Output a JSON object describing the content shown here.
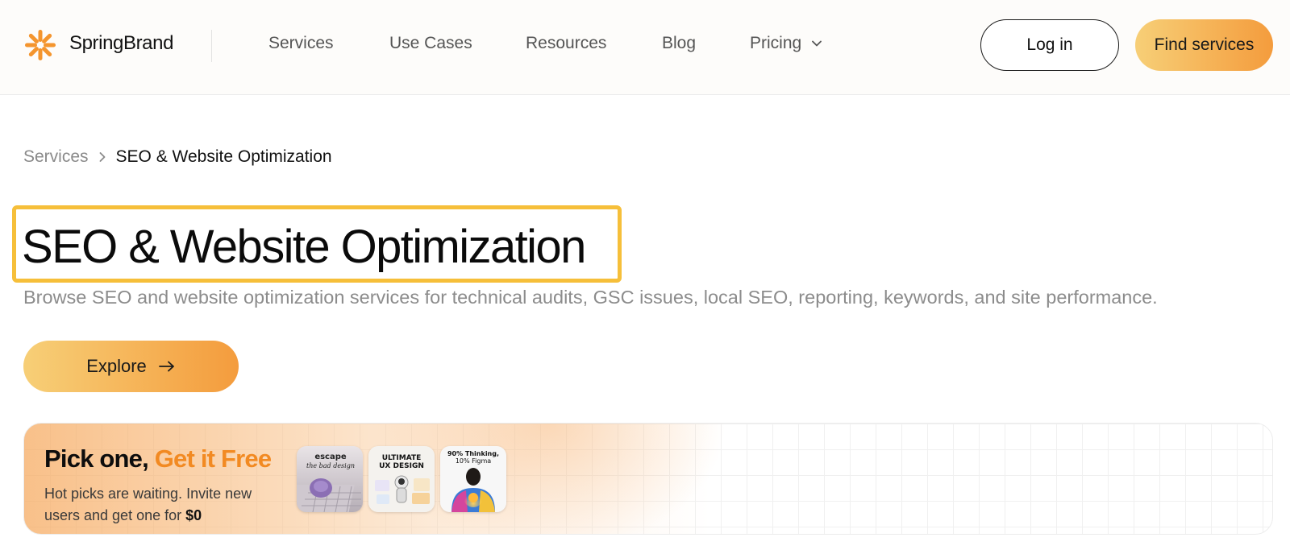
{
  "brand": {
    "name": "SpringBrand",
    "logo_icon": "spring-burst-icon",
    "color": "#f4952e"
  },
  "nav": {
    "items": [
      {
        "label": "Services"
      },
      {
        "label": "Use Cases"
      },
      {
        "label": "Resources"
      },
      {
        "label": "Blog"
      },
      {
        "label": "Pricing",
        "has_dropdown": true
      }
    ]
  },
  "auth": {
    "login_label": "Log in",
    "cta_label": "Find services"
  },
  "breadcrumb": {
    "parent": "Services",
    "current": "SEO & Website Optimization"
  },
  "hero": {
    "title": "SEO & Website Optimization",
    "subtitle": "Browse SEO and website optimization services for technical audits, GSC issues, local SEO, reporting, keywords, and site performance.",
    "explore_label": "Explore",
    "highlight_color": "#f6bf3a"
  },
  "promo": {
    "title_start": "Pick one, ",
    "title_accent": "Get it Free",
    "text": "Hot picks are waiting. Invite new users and get one for ",
    "price": "$0",
    "accent_color": "#f28a22",
    "thumbnails": [
      {
        "line1": "escape",
        "line2": "the bad design"
      },
      {
        "line1": "ULTIMATE",
        "line2": "UX DESIGN"
      },
      {
        "line1": "90% Thinking,",
        "line2": "10% Figma"
      }
    ]
  },
  "theme": {
    "gradient_start": "#f7cf77",
    "gradient_end": "#f49c3d"
  }
}
